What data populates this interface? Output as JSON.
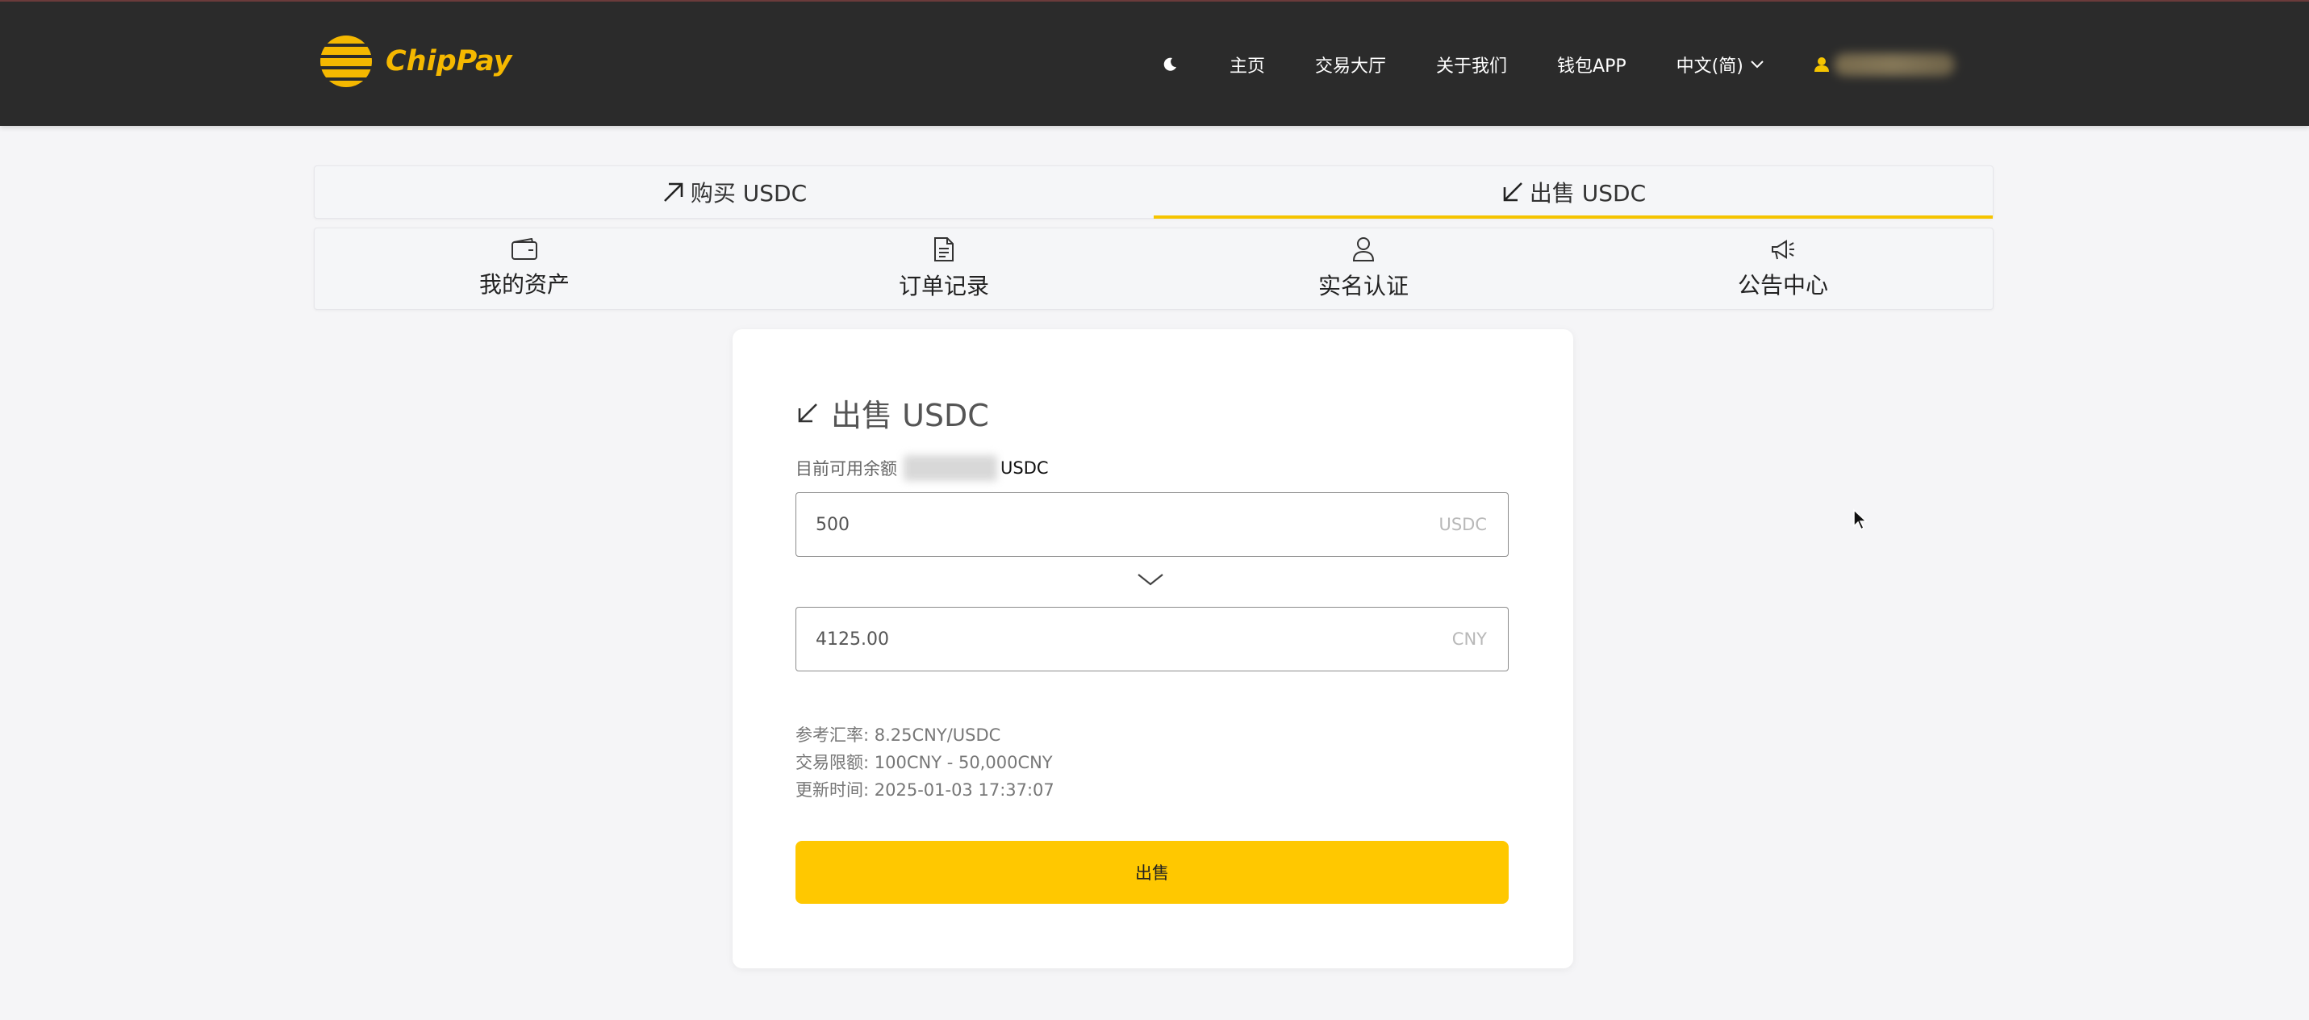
{
  "brand": {
    "name": "ChipPay",
    "color": "#f5b800"
  },
  "nav": {
    "theme_icon": "moon-icon",
    "items": [
      {
        "label": "主页"
      },
      {
        "label": "交易大厅"
      },
      {
        "label": "关于我们"
      },
      {
        "label": "钱包APP"
      }
    ],
    "language": "中文(简)",
    "user_icon": "user-icon"
  },
  "direction_tabs": [
    {
      "label": "购买 USDC",
      "icon": "arrow-up-right-icon",
      "active": false
    },
    {
      "label": "出售 USDC",
      "icon": "arrow-down-left-icon",
      "active": true
    }
  ],
  "menu": [
    {
      "label": "我的资产",
      "icon": "wallet-icon"
    },
    {
      "label": "订单记录",
      "icon": "document-icon"
    },
    {
      "label": "实名认证",
      "icon": "user-icon"
    },
    {
      "label": "公告中心",
      "icon": "megaphone-icon"
    }
  ],
  "sell_form": {
    "title": "出售 USDC",
    "balance_label": "目前可用余额",
    "balance_unit": "USDC",
    "amount_value": "500",
    "amount_unit": "USDC",
    "receive_value": "4125.00",
    "receive_unit": "CNY",
    "rate_text": "参考汇率: 8.25CNY/USDC",
    "limit_text": "交易限额: 100CNY - 50,000CNY",
    "updated_text": "更新时间: 2025-01-03 17:37:07",
    "submit_label": "出售"
  },
  "colors": {
    "accent": "#ffc800",
    "header_bg": "#2b2b2b",
    "page_bg": "#f5f5f7"
  }
}
